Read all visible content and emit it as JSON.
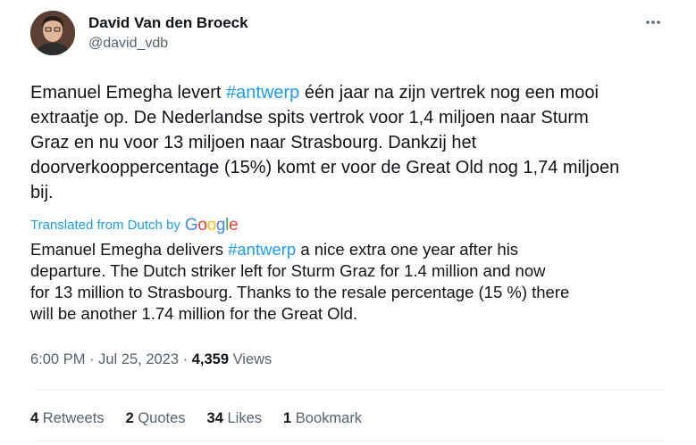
{
  "author": {
    "display_name": "David Van den Broeck",
    "handle": "@david_vdb"
  },
  "more_icon": "more-dots-icon",
  "tweet": {
    "nl_part1": "Emanuel Emegha levert ",
    "nl_hashtag": "#antwerp",
    "nl_part2": " één jaar na zijn vertrek nog een mooi\nextraatje op. De Nederlandse spits vertrok voor 1,4 miljoen naar Sturm\nGraz en nu voor 13 miljoen naar Strasbourg. Dankzij het\ndoorverkooppercentage (15%) komt er voor de Great Old nog 1,74 miljoen\nbij.",
    "translated_label": "Translated from Dutch by",
    "translator_logo": "Google",
    "en_part1": "Emanuel Emegha delivers ",
    "en_hashtag": "#antwerp",
    "en_part2": " a nice extra one year after his\ndeparture. The Dutch striker left for Sturm Graz for 1.4 million and now\nfor 13 million to Strasbourg. Thanks to the resale percentage (15 %) there\nwill be another 1.74 million for the Great Old."
  },
  "meta": {
    "time": "6:00 PM",
    "sep1": " · ",
    "date": "Jul 25, 2023",
    "sep2": " · ",
    "views_count": "4,359",
    "views_label": " Views"
  },
  "stats": {
    "retweets_count": "4",
    "retweets_label": " Retweets",
    "quotes_count": "2",
    "quotes_label": " Quotes",
    "likes_count": "34",
    "likes_label": " Likes",
    "bookmarks_count": "1",
    "bookmarks_label": " Bookmark"
  },
  "colors": {
    "accent": "#1d9bf0",
    "text": "#0f1419",
    "secondary": "#536471",
    "divider": "#eff3f4"
  }
}
